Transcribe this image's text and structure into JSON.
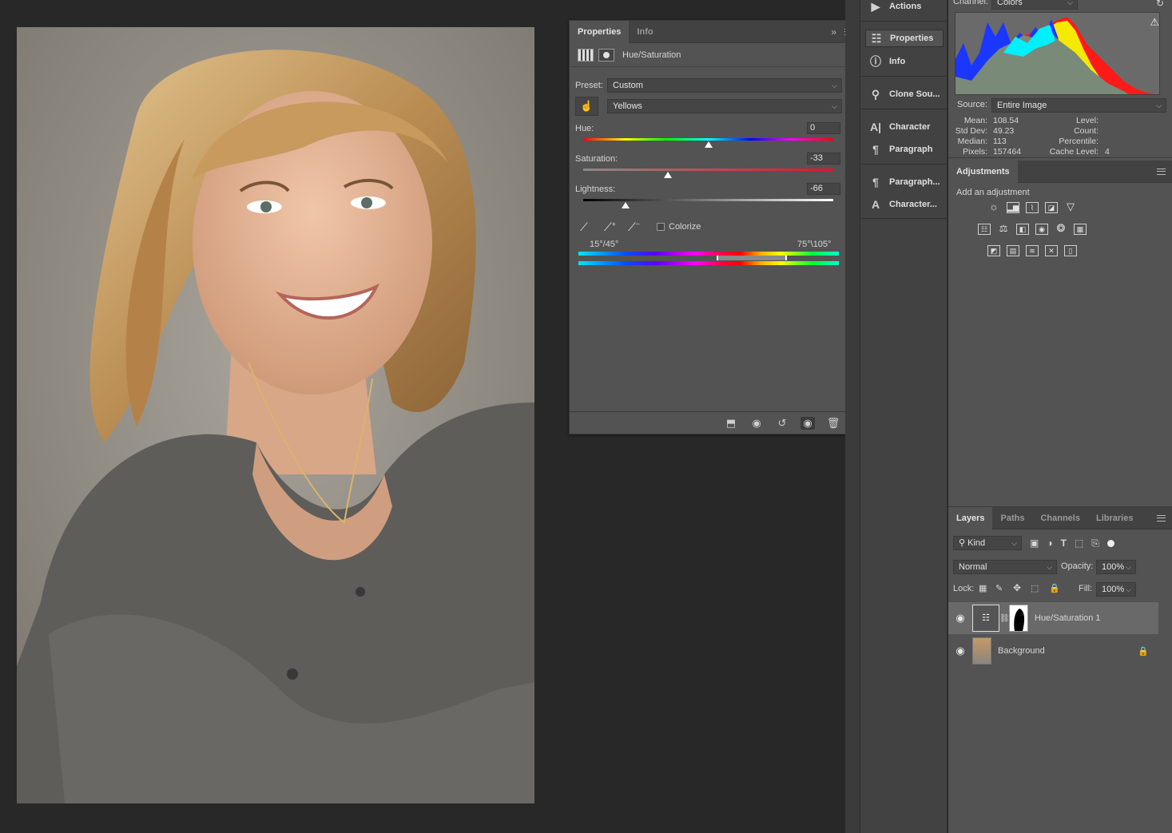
{
  "properties_panel": {
    "tabs": [
      "Properties",
      "Info"
    ],
    "adjustment_title": "Hue/Saturation",
    "preset_label": "Preset:",
    "preset_value": "Custom",
    "channel_value": "Yellows",
    "hue_label": "Hue:",
    "hue_value": "0",
    "saturation_label": "Saturation:",
    "saturation_value": "-33",
    "lightness_label": "Lightness:",
    "lightness_value": "-66",
    "colorize_label": "Colorize",
    "range_left": "15°/45°",
    "range_right": "75°\\105°",
    "slider_levels": {
      "hue": 0.5,
      "saturation": 0.34,
      "lightness": 0.17
    }
  },
  "dock": {
    "items": [
      "Actions",
      "Properties",
      "Info",
      "Clone Sou...",
      "Character",
      "Paragraph",
      "Paragraph...",
      "Character..."
    ]
  },
  "histogram": {
    "channel_label": "Channel:",
    "channel_value": "Colors",
    "source_label": "Source:",
    "source_value": "Entire Image",
    "mean_label": "Mean:",
    "mean": "108.54",
    "std_label": "Std Dev:",
    "std": "49.23",
    "median_label": "Median:",
    "median": "113",
    "pixels_label": "Pixels:",
    "pixels": "157464",
    "level_label": "Level:",
    "count_label": "Count:",
    "percentile_label": "Percentile:",
    "cache_label": "Cache Level:",
    "cache": "4"
  },
  "adjustments": {
    "tab": "Adjustments",
    "subtitle": "Add an adjustment"
  },
  "layers": {
    "tabs": [
      "Layers",
      "Paths",
      "Channels",
      "Libraries"
    ],
    "filter_label": "Kind",
    "blend_mode": "Normal",
    "opacity_label": "Opacity:",
    "opacity": "100%",
    "lock_label": "Lock:",
    "fill_label": "Fill:",
    "fill": "100%",
    "rows": [
      {
        "name": "Hue/Saturation 1"
      },
      {
        "name": "Background"
      }
    ]
  }
}
